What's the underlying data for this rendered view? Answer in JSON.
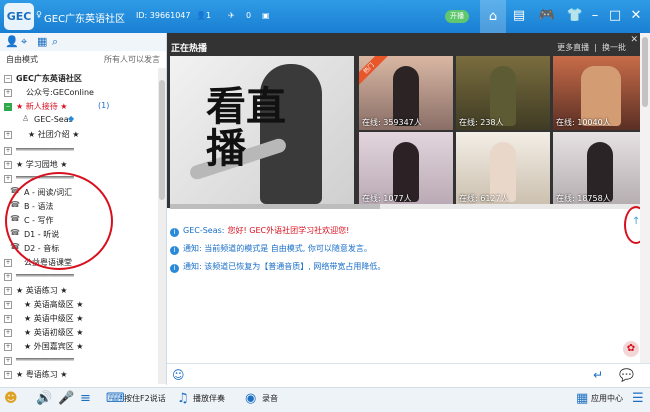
{
  "header": {
    "logo_text": "GEC",
    "title": "GEC广东英语社区",
    "room_id": "ID: 39661047",
    "online_count": "1",
    "fans_count": "0",
    "open_badge": "开播",
    "icons": [
      "gender-icon",
      "user-icon",
      "plane-icon",
      "gift-icon",
      "home-icon",
      "calendar-icon",
      "gamepad-icon",
      "shirt-icon",
      "minimize-icon",
      "maximize-icon",
      "close-icon"
    ]
  },
  "left": {
    "mode_label": "自由模式",
    "mode_note": "所有人可以发言",
    "tree": [
      {
        "text": "GEC广东英语社区",
        "bold": true
      },
      {
        "text": "公众号:GEConline"
      },
      {
        "text": "★ 新人接待 ★",
        "suffix": "(1)",
        "red": true
      },
      {
        "text": "GEC-Seas"
      },
      {
        "text": "★ 社团介绍 ★"
      },
      {
        "text": "════════════"
      },
      {
        "text": "★ 学习园地 ★"
      },
      {
        "text": "════════════"
      },
      {
        "text": "A - 阅读/词汇"
      },
      {
        "text": "B - 语法"
      },
      {
        "text": "C - 写作"
      },
      {
        "text": "D1 - 听说"
      },
      {
        "text": "D2 - 音标"
      },
      {
        "text": "公益粤语课堂"
      },
      {
        "text": "════════════"
      },
      {
        "text": "★ 英语练习 ★"
      },
      {
        "text": "★ 英语高级区 ★"
      },
      {
        "text": "★ 英语中级区 ★"
      },
      {
        "text": "★ 英语初级区 ★"
      },
      {
        "text": "★ 外国嘉宾区 ★"
      },
      {
        "text": "════════════"
      },
      {
        "text": "★ 粤语练习 ★"
      }
    ]
  },
  "hot": {
    "title": "正在热播",
    "more": "更多直播",
    "refresh": "换一批",
    "main_text": "看直播",
    "tiles": [
      {
        "viewers": "在线: 359347人",
        "badge": "热门"
      },
      {
        "viewers": "在线: 238人"
      },
      {
        "viewers": "在线: 10040人"
      },
      {
        "viewers": "在线: 1077人"
      },
      {
        "viewers": "在线: 6127人"
      },
      {
        "viewers": "在线: 18758人"
      }
    ]
  },
  "chat": {
    "messages": [
      {
        "sender": "GEC-Seas:",
        "text": "您好! GEC外语社团学习社欢迎您!"
      },
      {
        "label": "通知:",
        "text": "当前频道的模式是 自由模式, 你可以随意发言。"
      },
      {
        "label": "通知:",
        "text": "该频道已恢复为【普通音质】, 网络带宽占用降低。"
      }
    ]
  },
  "bottom": {
    "ptt": "按住F2说话",
    "accompany": "播放伴奏",
    "record": "录音",
    "app_center": "应用中心"
  },
  "colors": {
    "brand_blue": "#1a7fd2",
    "notice_blue": "#1a6fc9",
    "welcome_red": "#d8101e",
    "annotation_red": "#d8101e"
  }
}
